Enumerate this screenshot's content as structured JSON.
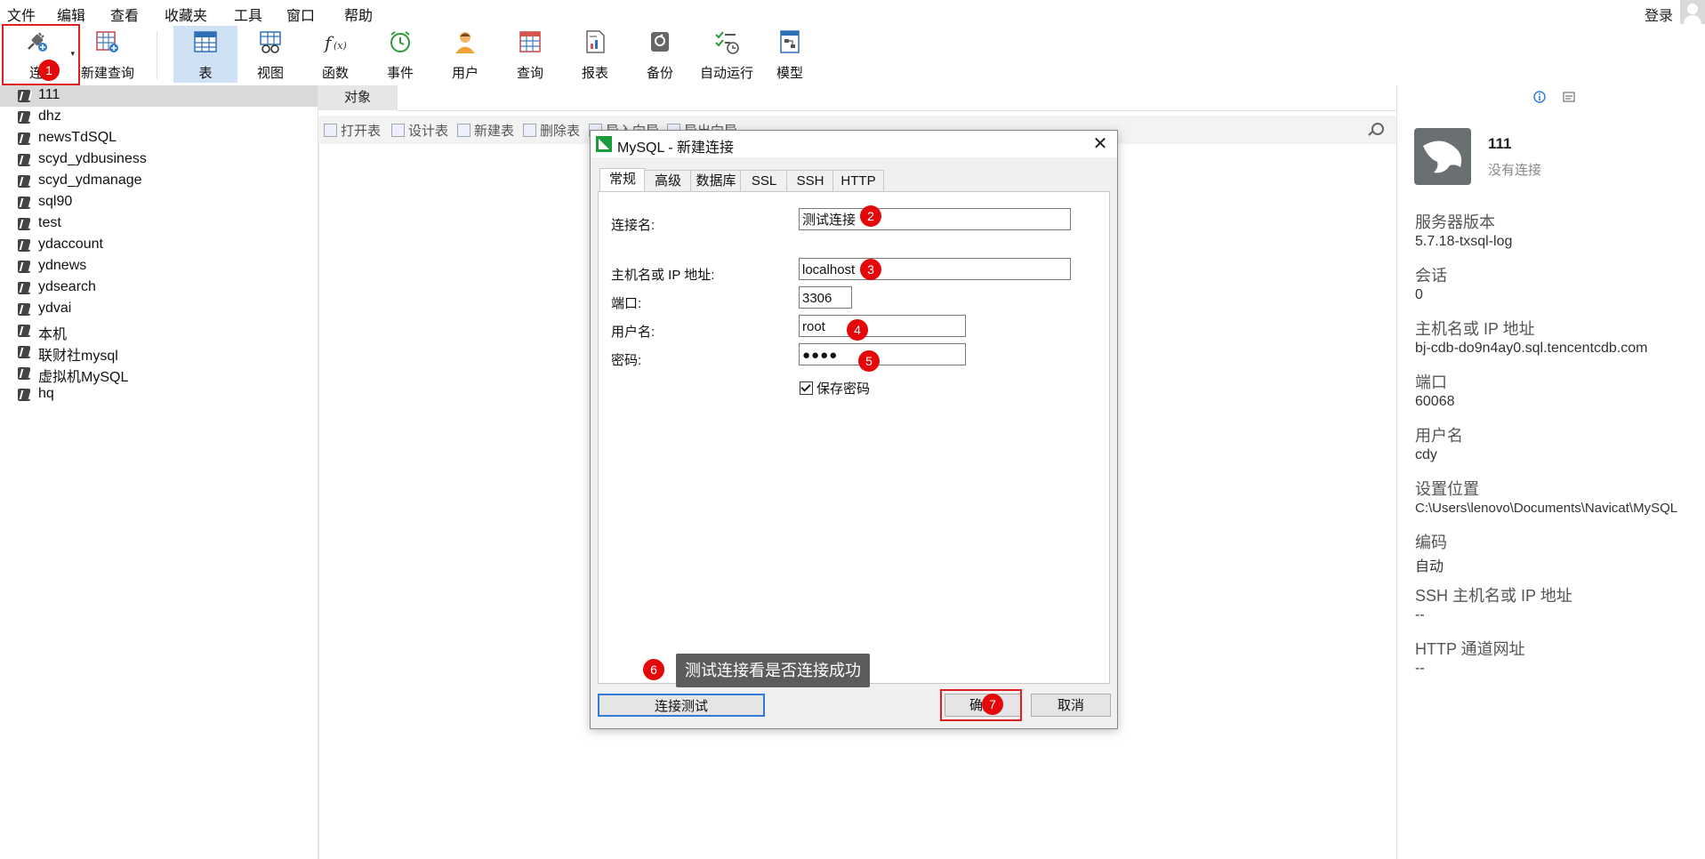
{
  "menu": {
    "items": [
      "文件",
      "编辑",
      "查看",
      "收藏夹",
      "工具",
      "窗口",
      "帮助"
    ],
    "login": "登录"
  },
  "toolbar": {
    "connect": "连接",
    "new_query": "新建查询",
    "table": "表",
    "view": "视图",
    "function": "函数",
    "event": "事件",
    "user": "用户",
    "query": "查询",
    "report": "报表",
    "backup": "备份",
    "automation": "自动运行",
    "model": "模型"
  },
  "tree": {
    "items": [
      "111",
      "dhz",
      "newsTdSQL",
      "scyd_ydbusiness",
      "scyd_ydmanage",
      "sql90",
      "test",
      "ydaccount",
      "ydnews",
      "ydsearch",
      "ydvai",
      "本机",
      "联财社mysql",
      "虚拟机MySQL",
      "hq"
    ]
  },
  "objects": {
    "tab": "对象",
    "open_table": "打开表",
    "design_table": "设计表",
    "new_table": "新建表",
    "delete_table": "删除表",
    "import_wizard": "导入向导",
    "export_wizard": "导出向导"
  },
  "info": {
    "conn_name": "111",
    "conn_status": "没有连接",
    "server_version_label": "服务器版本",
    "server_version": "5.7.18-txsql-log",
    "session_label": "会话",
    "session": "0",
    "host_label": "主机名或 IP 地址",
    "host": "bj-cdb-do9n4ay0.sql.tencentcdb.com",
    "port_label": "端口",
    "port": "60068",
    "user_label": "用户名",
    "user": "cdy",
    "location_label": "设置位置",
    "location": "C:\\Users\\lenovo\\Documents\\Navicat\\MySQL",
    "encoding_label": "编码",
    "encoding": "自动",
    "ssh_label": "SSH 主机名或 IP 地址",
    "ssh": "--",
    "http_label": "HTTP 通道网址",
    "http": "--"
  },
  "dialog": {
    "title": "MySQL - 新建连接",
    "close": "✕",
    "tabs": [
      "常规",
      "高级",
      "数据库",
      "SSL",
      "SSH",
      "HTTP"
    ],
    "conn_name_label": "连接名:",
    "conn_name_value": "测试连接",
    "host_label": "主机名或 IP 地址:",
    "host_value": "localhost",
    "port_label": "端口:",
    "port_value": "3306",
    "user_label": "用户名:",
    "user_value": "root",
    "password_label": "密码:",
    "password_value": "●●●●",
    "save_password_label": "保存密码",
    "save_password_checked": true,
    "test_button": "连接测试",
    "ok_button": "确定",
    "cancel_button": "取消",
    "tooltip": "测试连接看是否连接成功"
  },
  "annotations": [
    "1",
    "2",
    "3",
    "4",
    "5",
    "6",
    "7"
  ],
  "colors": {
    "accent": "#cfe1f5",
    "annotation_red": "#e4080a",
    "highlight_border": "#e02020"
  }
}
